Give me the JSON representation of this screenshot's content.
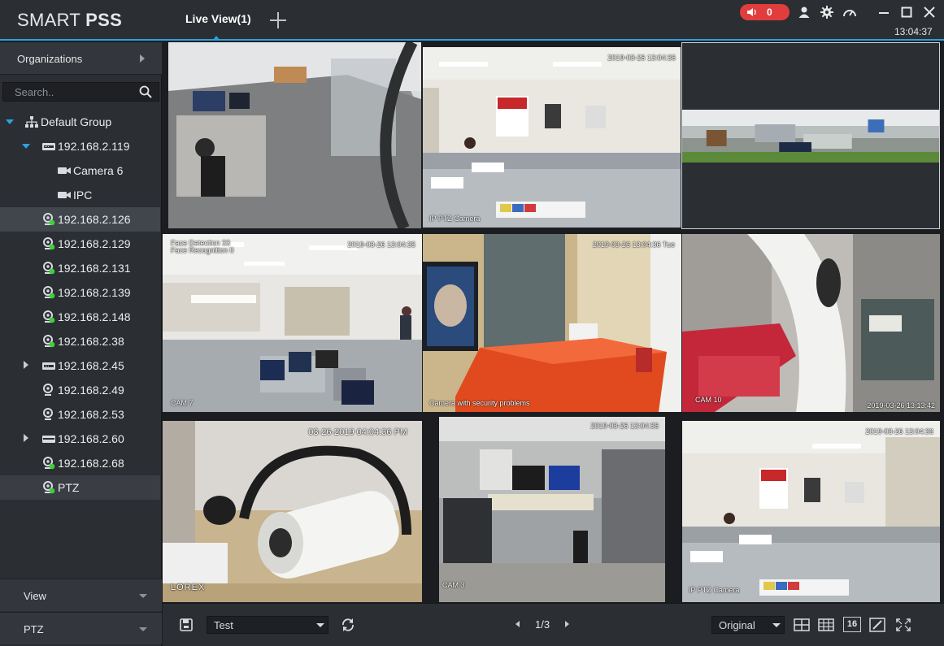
{
  "app": {
    "logo_light": "SMART ",
    "logo_bold": "PSS",
    "tab_live": "Live View(1)",
    "alarm_count": "0",
    "clock": "13:04:37",
    "colors": {
      "accent": "#2aa3e0",
      "alarm": "#e23d3d",
      "online": "#3ad13a",
      "background": "#2b2e33"
    }
  },
  "sidebar": {
    "organizations_label": "Organizations",
    "search_placeholder": "Search..",
    "tree": [
      {
        "label": "Default Group",
        "icon": "group-icon",
        "expanded": true
      },
      {
        "label": "192.168.2.119",
        "icon": "nvr-icon",
        "expanded": true
      },
      {
        "label": "Camera 6",
        "icon": "camera-icon"
      },
      {
        "label": "IPC",
        "icon": "camera-icon"
      },
      {
        "label": "192.168.2.126",
        "icon": "ipc-online-icon",
        "selected": true
      },
      {
        "label": "192.168.2.129",
        "icon": "ipc-online-icon"
      },
      {
        "label": "192.168.2.131",
        "icon": "ipc-online-icon"
      },
      {
        "label": "192.168.2.139",
        "icon": "ipc-online-icon"
      },
      {
        "label": "192.168.2.148",
        "icon": "ipc-online-icon"
      },
      {
        "label": "192.168.2.38",
        "icon": "ipc-online-icon"
      },
      {
        "label": "192.168.2.45",
        "icon": "nvr-icon",
        "expanded": false
      },
      {
        "label": "192.168.2.49",
        "icon": "ipc-icon"
      },
      {
        "label": "192.168.2.53",
        "icon": "ipc-icon"
      },
      {
        "label": "192.168.2.60",
        "icon": "nvr-icon",
        "expanded": false
      },
      {
        "label": "192.168.2.68",
        "icon": "ipc-online-icon"
      },
      {
        "label": "PTZ",
        "icon": "ipc-online-icon",
        "highlighted": true
      }
    ],
    "view_label": "View",
    "ptz_label": "PTZ"
  },
  "tiles": [
    {
      "osd": []
    },
    {
      "osd": [
        "2019-03-26 13:04:36",
        "IP PTZ Camera"
      ]
    },
    {
      "osd": []
    },
    {
      "osd": [
        "Face Detection 33",
        "Face Recognition 0",
        "2019-03-26 13:04:35",
        "CAM 7"
      ]
    },
    {
      "osd": [
        "2019-03-26 13:04:36 Tue",
        "Camera with security problems"
      ]
    },
    {
      "osd": [
        "CAM 10",
        "2019-03-26 13:13:42"
      ]
    },
    {
      "osd": [
        "03-26-2019 04:04:36 PM",
        "LOREX"
      ]
    },
    {
      "osd": [
        "2019-03-26 13:04:36",
        "CAM 3"
      ]
    },
    {
      "osd": [
        "2019-03-26 13:04:36",
        "IP PTZ Camera"
      ]
    }
  ],
  "toolbar": {
    "view_select": "Test",
    "page": "1/3",
    "stream_select": "Original",
    "layout_16": "16"
  }
}
